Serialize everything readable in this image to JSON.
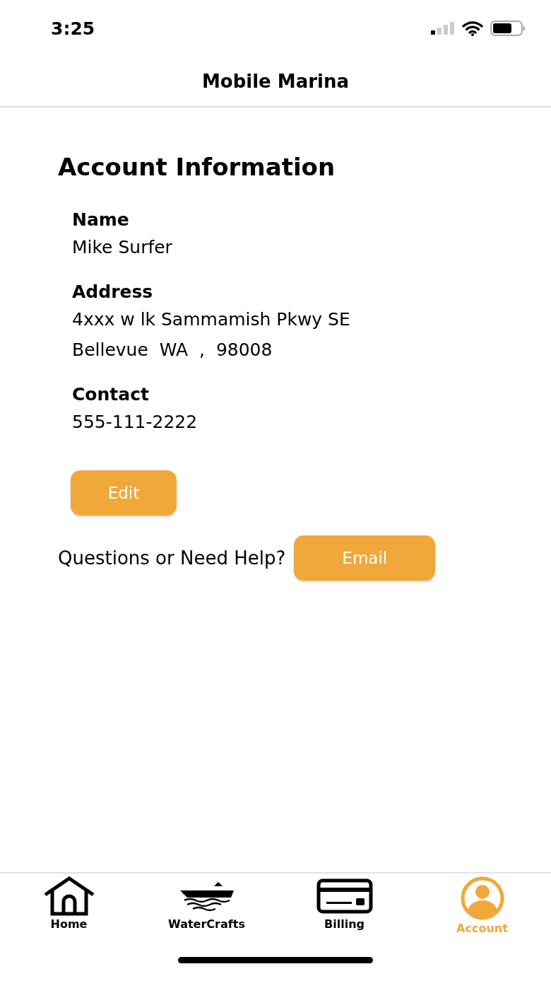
{
  "status_bar": {
    "time": "3:25"
  },
  "header": {
    "title": "Mobile Marina"
  },
  "section": {
    "title": "Account Information"
  },
  "fields": [
    {
      "label": "Name",
      "lines": [
        "Mike Surfer"
      ]
    },
    {
      "label": "Address",
      "lines": [
        "4xxx w lk Sammamish Pkwy SE",
        "Bellevue  WA  ,  98008"
      ]
    },
    {
      "label": "Contact",
      "lines": [
        "555-111-2222"
      ]
    }
  ],
  "edit_button": "Edit",
  "help": {
    "text": "Questions or Need Help?",
    "button": "Email"
  },
  "tab_bar": [
    {
      "kind": "home",
      "label": "Home",
      "selected": false
    },
    {
      "kind": "boat",
      "label": "WaterCrafts",
      "selected": false
    },
    {
      "kind": "card",
      "label": "Billing",
      "selected": false
    },
    {
      "kind": "account",
      "label": "Account",
      "selected": true
    }
  ]
}
